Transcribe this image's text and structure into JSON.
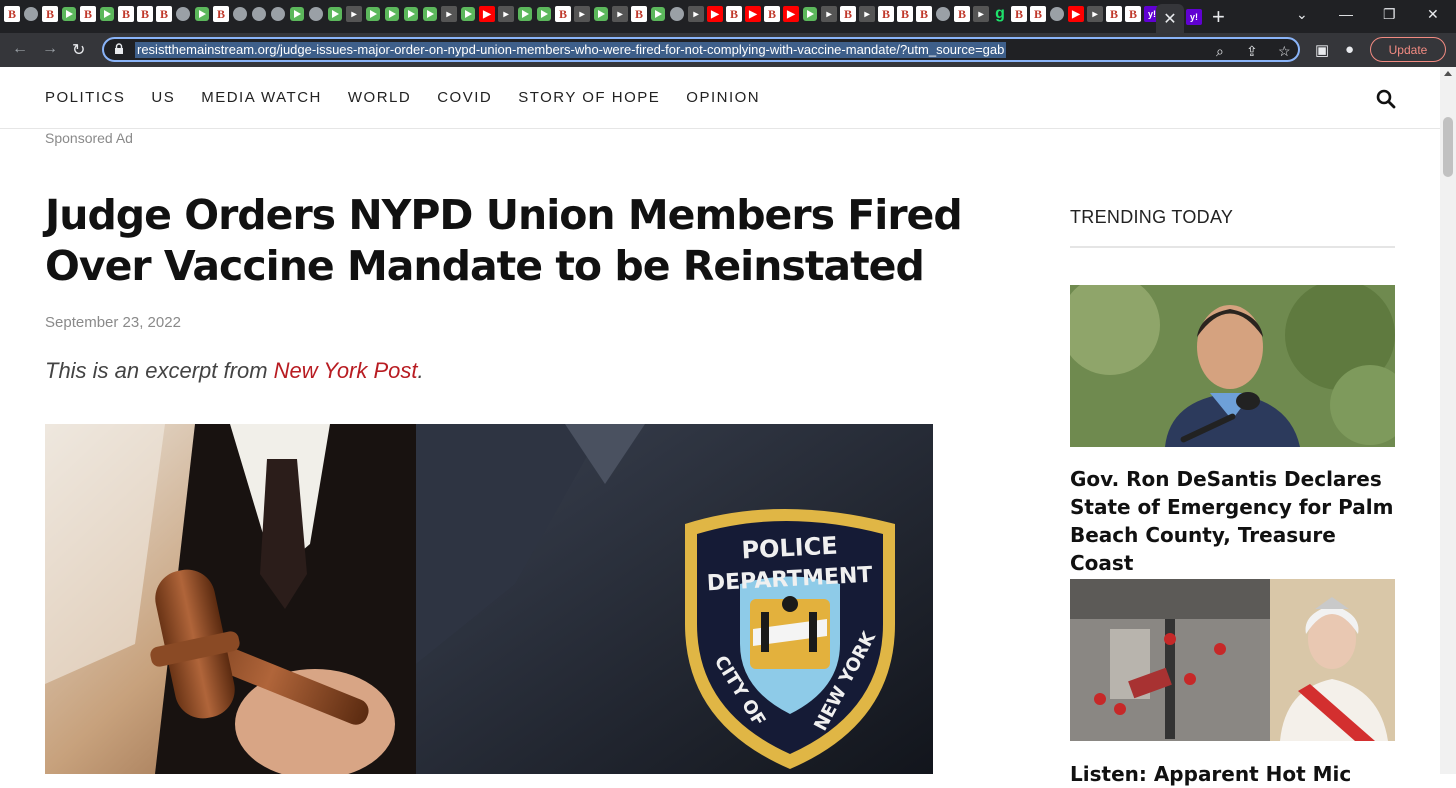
{
  "browser": {
    "url": "resistthemainstream.org/judge-issues-major-order-on-nypd-union-members-who-were-fired-for-not-complying-with-vaccine-mandate/?utm_source=gab",
    "update_label": "Update",
    "tab_close": "✕",
    "new_tab": "+",
    "tab_icons": [
      "BI",
      "globe",
      "BI",
      "play",
      "BI",
      "play",
      "BI",
      "BI",
      "BI",
      "globe",
      "play",
      "BI",
      "globe",
      "globe",
      "globe",
      "play",
      "globe",
      "play",
      "dark",
      "play",
      "play",
      "play",
      "play",
      "dark",
      "play",
      "yt",
      "dark",
      "play",
      "play",
      "BI",
      "dark",
      "play",
      "dark",
      "BI",
      "play",
      "globe",
      "dark",
      "yt",
      "BI",
      "yt",
      "BI",
      "yt",
      "play",
      "dark",
      "BI",
      "dark",
      "BI",
      "BI",
      "BI",
      "globe",
      "BI",
      "dark",
      "g",
      "BI",
      "BI",
      "globe",
      "yt",
      "dark",
      "BI",
      "BI",
      "y",
      "g"
    ]
  },
  "nav": {
    "items": [
      "POLITICS",
      "US",
      "MEDIA WATCH",
      "WORLD",
      "COVID",
      "STORY OF HOPE",
      "OPINION"
    ]
  },
  "article": {
    "sponsored": "Sponsored Ad",
    "headline": "Judge Orders NYPD Union Members Fired Over Vaccine Mandate to be Reinstated",
    "date": "September 23, 2022",
    "excerpt_prefix": "This is an excerpt from ",
    "excerpt_source": "New York Post",
    "excerpt_suffix": ".",
    "patch_text_top": "POLICE",
    "patch_text_mid": "DEPARTMENT",
    "patch_text_left": "CITY OF",
    "patch_text_right": "NEW YORK"
  },
  "sidebar": {
    "title": "TRENDING TODAY",
    "stories": [
      {
        "headline": "Gov. Ron DeSantis Declares State of Emergency for Palm Beach County, Treasure Coast"
      },
      {
        "headline": "Listen: Apparent Hot Mic"
      }
    ]
  },
  "colors": {
    "accent_link": "#b81c22",
    "chrome_dark": "#202124",
    "omnibox_focus": "#8ab4f8"
  }
}
